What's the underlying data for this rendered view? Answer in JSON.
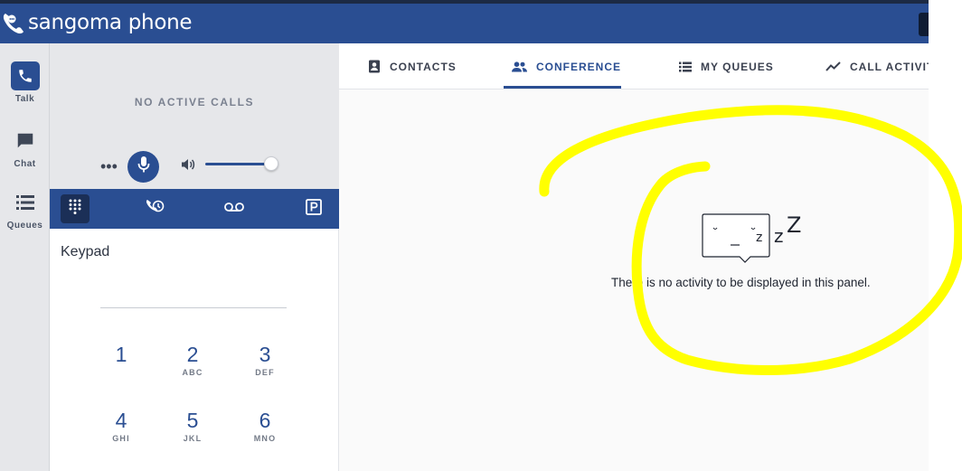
{
  "app": {
    "title": "sangoma phone",
    "logo_icon": "sangoma-logo-icon"
  },
  "rail": {
    "items": [
      {
        "label": "Talk",
        "icon": "phone-icon",
        "active": true
      },
      {
        "label": "Chat",
        "icon": "chat-icon",
        "active": false
      },
      {
        "label": "Queues",
        "icon": "list-icon",
        "active": false
      }
    ]
  },
  "call_panel": {
    "status": "NO ACTIVE CALLS",
    "more_icon": "more-dots-icon",
    "mic_icon": "microphone-icon",
    "speaker_icon": "speaker-icon",
    "volume_level": 0.95
  },
  "toolbar": {
    "buttons": [
      {
        "icon": "dialpad-icon",
        "active": true
      },
      {
        "icon": "call-history-icon",
        "active": false
      },
      {
        "icon": "voicemail-icon",
        "active": false
      },
      {
        "icon": "parking-icon",
        "active": false
      }
    ]
  },
  "keypad": {
    "title": "Keypad",
    "keys": [
      {
        "num": "1",
        "letters": ""
      },
      {
        "num": "2",
        "letters": "ABC"
      },
      {
        "num": "3",
        "letters": "DEF"
      },
      {
        "num": "4",
        "letters": "GHI"
      },
      {
        "num": "5",
        "letters": "JKL"
      },
      {
        "num": "6",
        "letters": "MNO"
      }
    ]
  },
  "tabs": [
    {
      "label": "CONTACTS",
      "icon": "contacts-icon",
      "active": false
    },
    {
      "label": "CONFERENCE",
      "icon": "people-icon",
      "active": true
    },
    {
      "label": "MY QUEUES",
      "icon": "list-icon",
      "active": false
    },
    {
      "label": "CALL ACTIVIT",
      "icon": "activity-chart-icon",
      "active": false
    }
  ],
  "main": {
    "empty_message": "There is no activity to be displayed in this panel.",
    "empty_icon": "sleeping-bubble-icon",
    "sleep_text": "z",
    "sleep_text_large": "Z"
  },
  "colors": {
    "brand": "#2a4e92",
    "annotation": "#ffff00"
  }
}
